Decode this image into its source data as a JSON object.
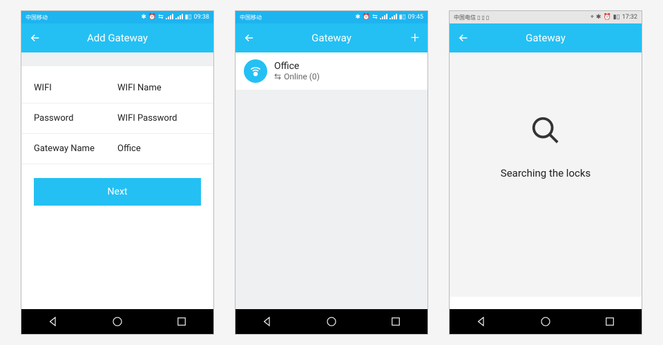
{
  "screens": [
    {
      "status_time": "09:38",
      "title": "Add Gateway",
      "form": {
        "wifi_label": "WIFI",
        "wifi_value": "WIFI Name",
        "password_label": "Password",
        "password_value": "WIFI Password",
        "gateway_label": "Gateway Name",
        "gateway_value": "Office"
      },
      "button": "Next"
    },
    {
      "status_time": "09:45",
      "title": "Gateway",
      "item": {
        "name": "Office",
        "status": "Online (0)"
      }
    },
    {
      "status_time": "17:32",
      "title": "Gateway",
      "searching_text": "Searching the locks"
    }
  ]
}
